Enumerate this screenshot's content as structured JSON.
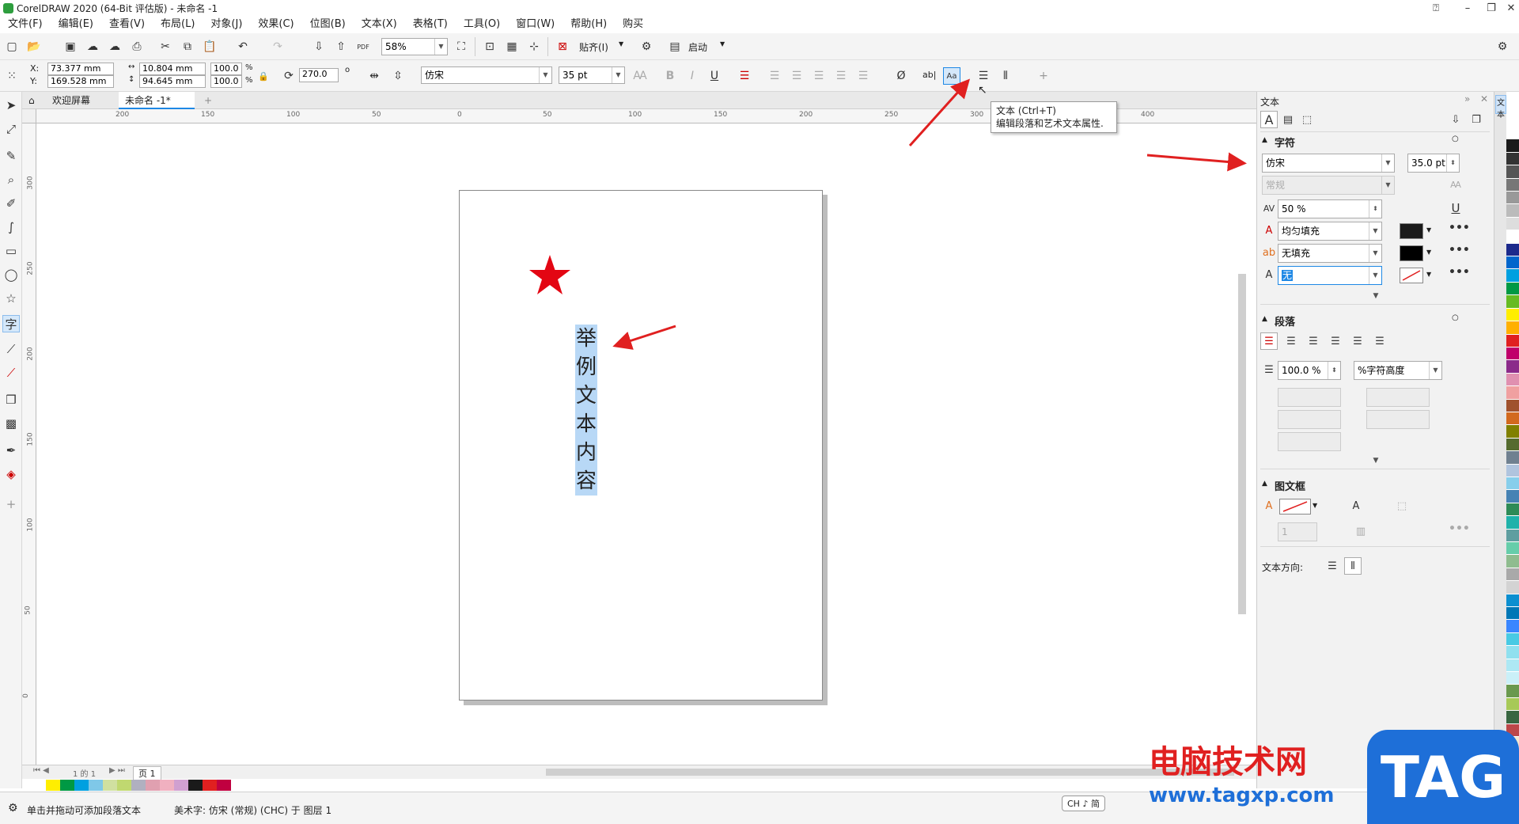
{
  "window": {
    "title": "CorelDRAW 2020 (64-Bit 评估版) - 未命名 -1"
  },
  "menu": [
    "文件(F)",
    "编辑(E)",
    "查看(V)",
    "布局(L)",
    "对象(J)",
    "效果(C)",
    "位图(B)",
    "文本(X)",
    "表格(T)",
    "工具(O)",
    "窗口(W)",
    "帮助(H)",
    "购买"
  ],
  "toolbar": {
    "zoom": "58%",
    "snap_label": "贴齐(I)",
    "launch_label": "启动",
    "pdf_label": "PDF"
  },
  "propbar": {
    "x_label": "X:",
    "y_label": "Y:",
    "x": "73.377 mm",
    "y": "169.528 mm",
    "w": "10.804 mm",
    "h": "94.645 mm",
    "sx": "100.0",
    "sy": "100.0",
    "pct": "%",
    "angle": "270.0",
    "deg": "o",
    "font": "仿宋",
    "size": "35 pt",
    "ab": "ab|"
  },
  "tabs": {
    "welcome": "欢迎屏幕",
    "doc": "未命名 -1*",
    "add": "+"
  },
  "ruler_h": [
    "200",
    "150",
    "100",
    "50",
    "0",
    "50",
    "100",
    "150",
    "200",
    "250",
    "300",
    "350",
    "400"
  ],
  "ruler_v": [
    "300",
    "250",
    "200",
    "150",
    "100",
    "50",
    "0"
  ],
  "canvas": {
    "vertical_text": [
      "举",
      "例",
      "文",
      "本",
      "内",
      "容"
    ]
  },
  "tooltip": {
    "title": "文本 (Ctrl+T)",
    "desc": "编辑段落和艺术文本属性."
  },
  "panel": {
    "title": "文本",
    "char_section": "字符",
    "font": "仿宋",
    "size": "35.0 pt",
    "style": "常规",
    "kerning": "50 %",
    "fill": "均匀填充",
    "bg_fill": "无填充",
    "outline": "无",
    "para_section": "段落",
    "line_spacing": "100.0 %",
    "spacing_unit": "%字符高度",
    "frame_section": "图文框",
    "columns": "1",
    "text_dir_label": "文本方向:",
    "side_tab": "文本"
  },
  "page_nav": {
    "pages": "1 的 1",
    "page_tab": "页 1"
  },
  "status": {
    "hint": "单击并拖动可添加段落文本",
    "info": "美术字: 仿宋 (常规) (CHC) 于 图层 1",
    "ime": "CH ♪ 简"
  },
  "watermark": {
    "text1": "电脑技术网",
    "url": "www.tagxp.com",
    "badge": "TAG"
  },
  "colors": {
    "accent": "#1e88e5",
    "star": "#e30613",
    "arrow": "#e02020",
    "selection": "#b8d8f6"
  }
}
